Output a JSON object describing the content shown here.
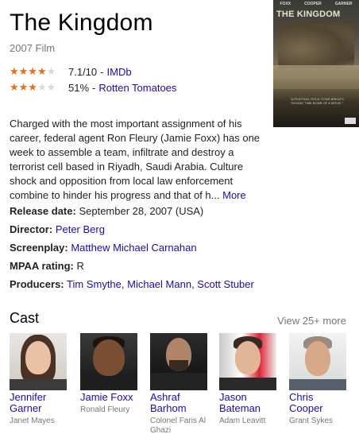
{
  "title": "The Kingdom",
  "subtitle": "2007 Film",
  "ratings": [
    {
      "stars_fraction": 0.71,
      "score": "7.1/10",
      "sep": "-",
      "source": "IMDb"
    },
    {
      "stars_fraction": 0.51,
      "score": "51%",
      "sep": "-",
      "source": "Rotten Tomatoes"
    }
  ],
  "poster": {
    "names": [
      "FOXX",
      "COOPER",
      "GARNER"
    ],
    "title": "THE KINGDOM",
    "tagline": "\"A RIVETING, HOLD-YOUR-BREATH TICKING TIME BOMB OF A MOVIE.\""
  },
  "description": {
    "text": "Charged with the most important assignment of his career, federal agent Ron Fleury (Jamie Foxx) has one week to assemble a team, infiltrate and destroy a terrorist cell based in Riyadh, Saudi Arabia. Culture shock and opposition from local law enforcement combine to hinder his progress and that of h...",
    "more_label": "More"
  },
  "facts": {
    "release": {
      "label": "Release date:",
      "value": "September 28, 2007 (USA)"
    },
    "director": {
      "label": "Director:",
      "value": "Peter Berg"
    },
    "screenplay": {
      "label": "Screenplay:",
      "value": "Matthew Michael Carnahan"
    },
    "mpaa": {
      "label": "MPAA rating:",
      "value": "R"
    },
    "producers": {
      "label": "Producers:",
      "values": [
        "Tim Smythe",
        "Michael Mann",
        "Scott Stuber"
      ],
      "sep": ", "
    }
  },
  "cast": {
    "heading": "Cast",
    "more_label": "View 25+ more",
    "members": [
      {
        "name": "Jennifer Garner",
        "role": "Janet Mayes"
      },
      {
        "name": "Jamie Foxx",
        "role": "Ronald Fleury"
      },
      {
        "name": "Ashraf Barhom",
        "role": "Colonel Faris Al Ghazi"
      },
      {
        "name": "Jason Bateman",
        "role": "Adam Leavitt"
      },
      {
        "name": "Chris Cooper",
        "role": "Grant Sykes"
      }
    ]
  },
  "colors": {
    "link": "#1a0dab",
    "star": "#e7711b",
    "muted": "#777777"
  }
}
